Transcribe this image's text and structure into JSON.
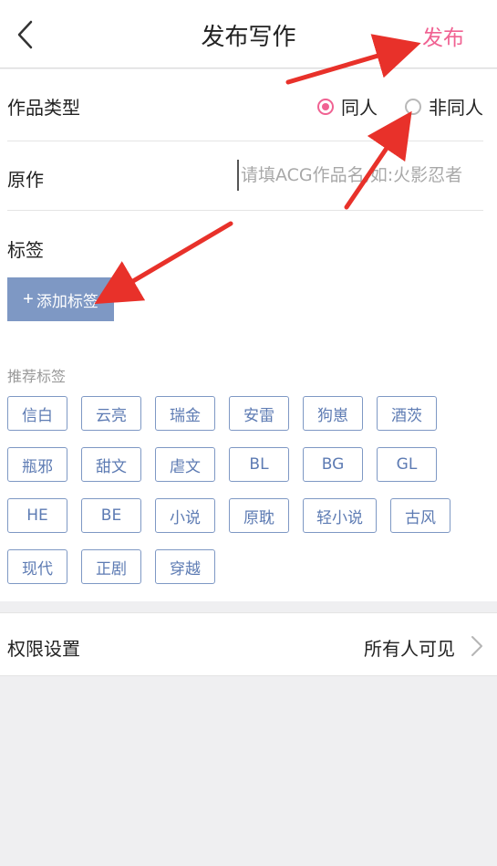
{
  "header": {
    "title": "发布写作",
    "publish_label": "发布"
  },
  "form": {
    "type": {
      "label": "作品类型",
      "options": [
        "同人",
        "非同人"
      ],
      "selected": "同人"
    },
    "original": {
      "label": "原作",
      "placeholder": "请填ACG作品名,如:火影忍者"
    },
    "tags": {
      "label": "标签",
      "add_button_label": "添加标签",
      "add_icon": "+"
    },
    "recommended": {
      "label": "推荐标签",
      "items": [
        "信白",
        "云亮",
        "瑞金",
        "安雷",
        "狗崽",
        "酒茨",
        "瓶邪",
        "甜文",
        "虐文",
        "BL",
        "BG",
        "GL",
        "HE",
        "BE",
        "小说",
        "原耽",
        "轻小说",
        "古风",
        "现代",
        "正剧",
        "穿越"
      ]
    }
  },
  "permission": {
    "label": "权限设置",
    "value": "所有人可见"
  },
  "colors": {
    "accent": "#f06292",
    "tag_blue": "#7e98c4",
    "annotation_red": "#e8312a"
  },
  "icons": {
    "back": "chevron-left-icon",
    "forward": "chevron-right-icon"
  }
}
